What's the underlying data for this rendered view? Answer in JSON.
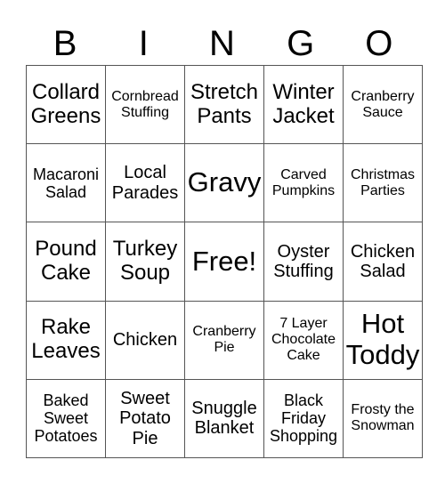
{
  "header": {
    "letters": [
      "B",
      "I",
      "N",
      "G",
      "O"
    ]
  },
  "grid": {
    "rows": [
      [
        "Collard Greens",
        "Cornbread Stuffing",
        "Stretch Pants",
        "Winter Jacket",
        "Cranberry Sauce"
      ],
      [
        "Macaroni Salad",
        "Local Parades",
        "Gravy",
        "Carved Pumpkins",
        "Christmas Parties"
      ],
      [
        "Pound Cake",
        "Turkey Soup",
        "Free!",
        "Oyster Stuffing",
        "Chicken Salad"
      ],
      [
        "Rake Leaves",
        "Chicken",
        "Cranberry Pie",
        "7 Layer Chocolate Cake",
        "Hot Toddy"
      ],
      [
        "Baked Sweet Potatoes",
        "Sweet Potato Pie",
        "Snuggle Blanket",
        "Black Friday Shopping",
        "Frosty the Snowman"
      ]
    ],
    "free_space": {
      "row": 2,
      "col": 2,
      "label": "Free!"
    }
  }
}
